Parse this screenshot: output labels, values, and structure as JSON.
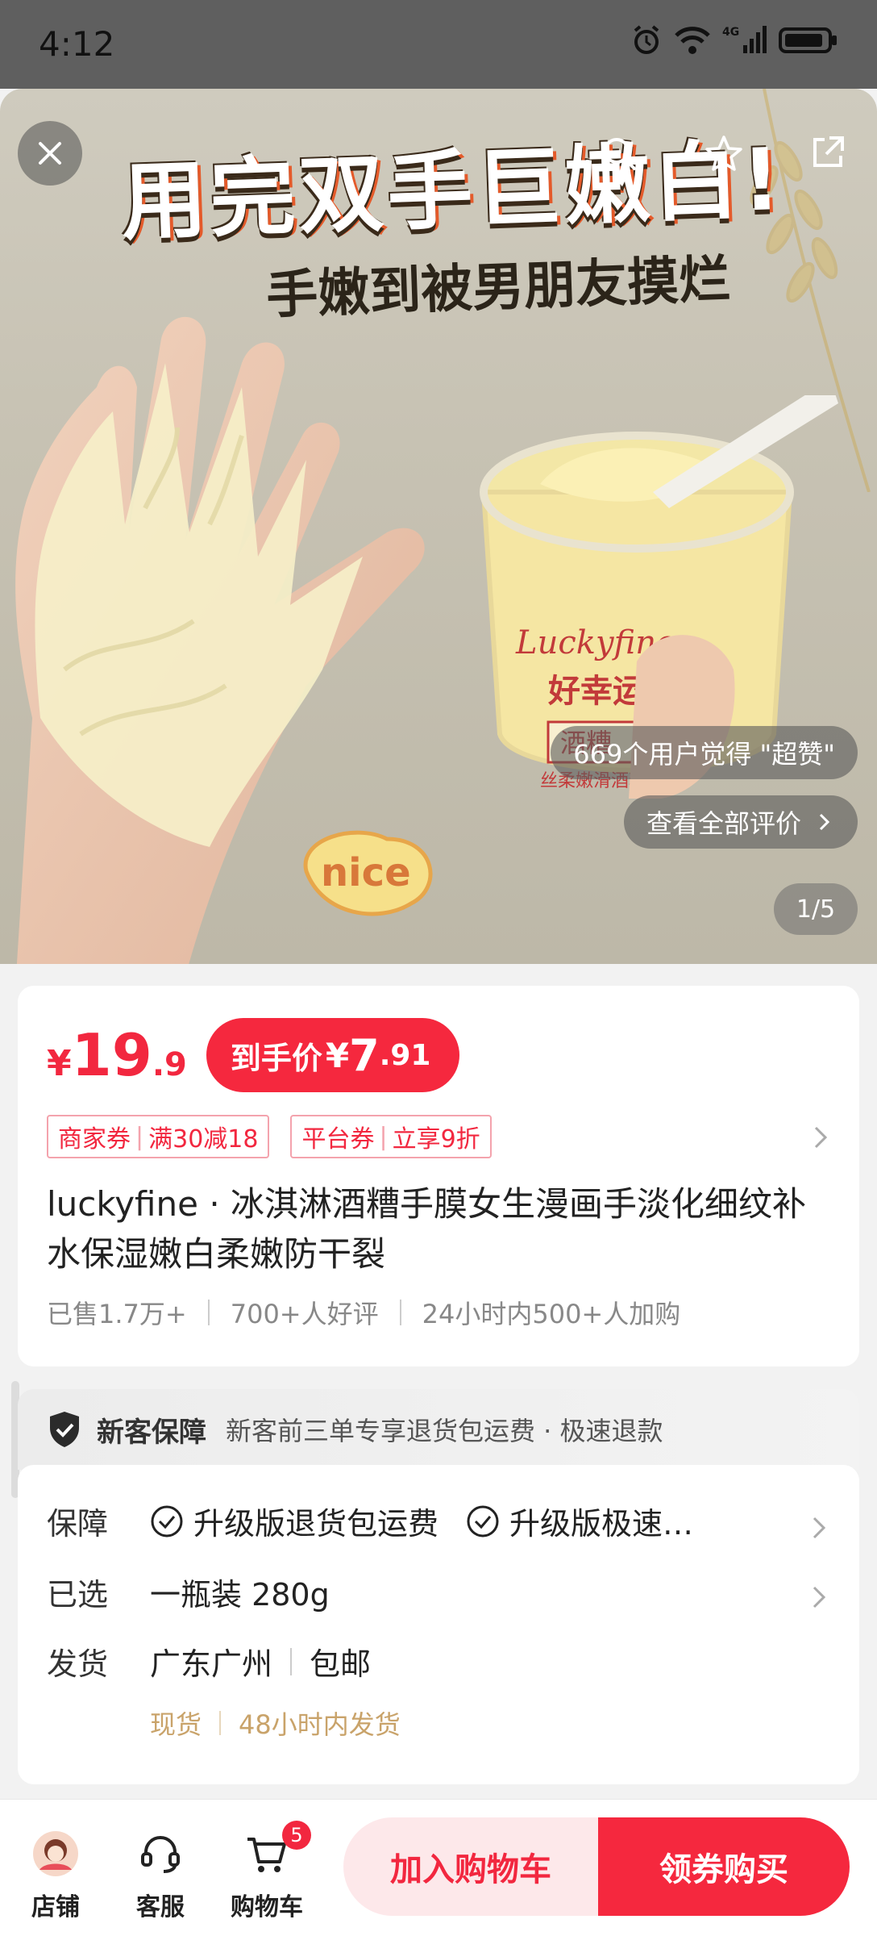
{
  "status_bar": {
    "time": "4:12",
    "network": "4G"
  },
  "hero": {
    "title": "用完双手巨嫩白!",
    "subtitle": "手嫩到被男朋友摸烂",
    "jar_brand": "Luckyfine",
    "jar_cn": "好幸运",
    "jar_label": "酒糟",
    "jar_desc": "丝柔嫩滑酒糟手膜",
    "sticker": "nice",
    "review_summary": "669个用户觉得 \"超赞\"",
    "review_all": "查看全部评价",
    "page_indicator": "1/5"
  },
  "price": {
    "yen": "¥",
    "integer": "19",
    "decimal": ".9",
    "final_label": "到手价",
    "final_yen": "¥",
    "final_integer": "7",
    "final_decimal": ".91",
    "accent_color": "#f2273f"
  },
  "coupons": [
    {
      "type": "商家券",
      "detail": "满30减18"
    },
    {
      "type": "平台券",
      "detail": "立享9折"
    }
  ],
  "product": {
    "title": "luckyfine · 冰淇淋酒糟手膜女生漫画手淡化细纹补水保湿嫩白柔嫩防干裂",
    "sales": [
      "已售1.7万+",
      "700+人好评",
      "24小时内500+人加购"
    ]
  },
  "guarantee": {
    "label": "新客保障",
    "desc": "新客前三单专享退货包运费 · 极速退款"
  },
  "info": {
    "guarantee_key": "保障",
    "guarantee_tags": [
      "升级版退货包运费",
      "升级版极速…"
    ],
    "selected_key": "已选",
    "selected_value": "一瓶装 280g",
    "ship_key": "发货",
    "ship_from": "广东广州",
    "ship_fee": "包邮",
    "stock": "现货",
    "ship_time": "48小时内发货"
  },
  "bottom_nav": {
    "shop": "店铺",
    "service": "客服",
    "cart": "购物车",
    "cart_count": "5",
    "add_to_cart": "加入购物车",
    "buy": "领券购买"
  }
}
